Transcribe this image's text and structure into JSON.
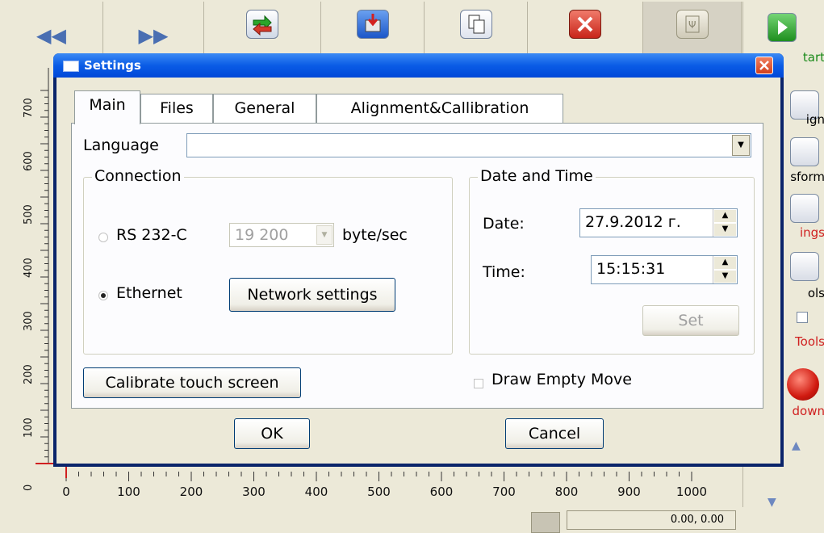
{
  "toolbar": {
    "prev_icon": "double-left-arrow-icon",
    "next_icon": "double-right-arrow-icon"
  },
  "right_panel": {
    "start_label": "tart",
    "design_label": "ign",
    "transform_label": "sform",
    "settings_label": "ings",
    "tools_label": "ols",
    "service_tools_label": "Tools",
    "shutdown_label": "down"
  },
  "plot": {
    "y_ticks": [
      "700",
      "600",
      "500",
      "400",
      "300",
      "200",
      "100",
      "0"
    ],
    "x_ticks": [
      "0",
      "100",
      "200",
      "300",
      "400",
      "500",
      "600",
      "700",
      "800",
      "900",
      "1000"
    ]
  },
  "status": {
    "coords": "0.00, 0.00"
  },
  "dialog": {
    "title": "Settings",
    "tabs": [
      "Main",
      "Files",
      "General",
      "Alignment&Callibration"
    ],
    "language_label": "Language",
    "language_value": "",
    "connection": {
      "title": "Connection",
      "rs232_label": "RS 232-C",
      "baud_value": "19 200",
      "baud_unit": "byte/sec",
      "ethernet_label": "Ethernet",
      "network_settings_label": "Network settings",
      "selected": "Ethernet"
    },
    "datetime": {
      "title": "Date and Time",
      "date_label": "Date:",
      "date_value": "27.9.2012 г.",
      "time_label": "Time:",
      "time_value": "15:15:31",
      "set_label": "Set"
    },
    "calibrate_label": "Calibrate touch screen",
    "draw_empty_move_label": "Draw Empty Move",
    "ok_label": "OK",
    "cancel_label": "Cancel"
  }
}
